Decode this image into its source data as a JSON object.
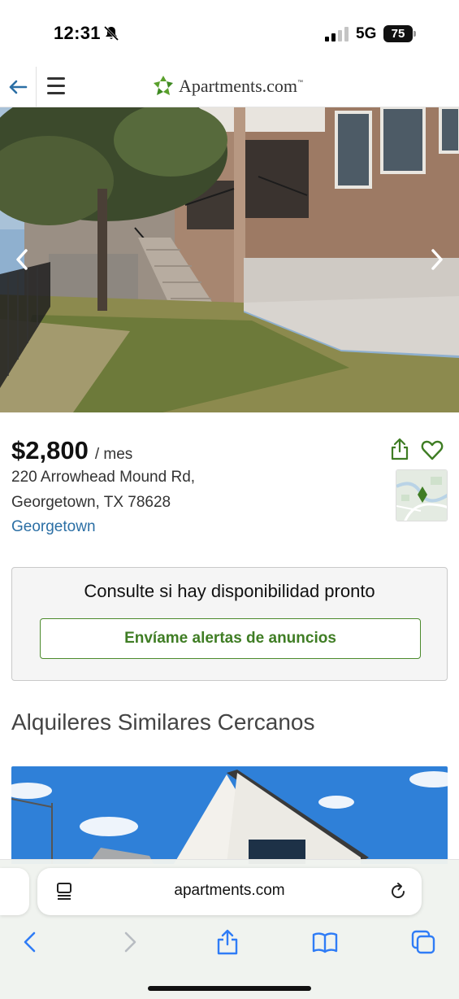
{
  "status_bar": {
    "time": "12:31",
    "network": "5G",
    "battery": "75",
    "icons": [
      "bell-slash-icon",
      "cellular-signal-icon",
      "battery-icon"
    ]
  },
  "header": {
    "brand_name": "Apartments.com",
    "brand_tm": "™",
    "icons": [
      "back-arrow-icon",
      "hamburger-menu-icon",
      "apartments-logo-icon"
    ],
    "accent_color": "#2b6fa5"
  },
  "gallery": {
    "icons": [
      "chevron-left-icon",
      "chevron-right-icon"
    ]
  },
  "listing": {
    "price": "$2,800",
    "price_unit": "/ mes",
    "address_line1": "220 Arrowhead Mound Rd,",
    "address_line2": "Georgetown, TX 78628",
    "neighborhood": "Georgetown",
    "icons": [
      "share-icon",
      "heart-icon",
      "map-pin-icon"
    ],
    "action_color": "#3f7d24"
  },
  "availability": {
    "title": "Consulte si hay disponibilidad pronto",
    "button_label": "Envíame alertas de anuncios"
  },
  "similar": {
    "title": "Alquileres Similares Cercanos"
  },
  "browser": {
    "url": "apartments.com",
    "icons": [
      "reader-mode-icon",
      "reload-icon",
      "back-icon",
      "forward-icon",
      "share-icon",
      "bookmarks-icon",
      "tabs-icon"
    ],
    "accent_color": "#2f7cf6"
  }
}
